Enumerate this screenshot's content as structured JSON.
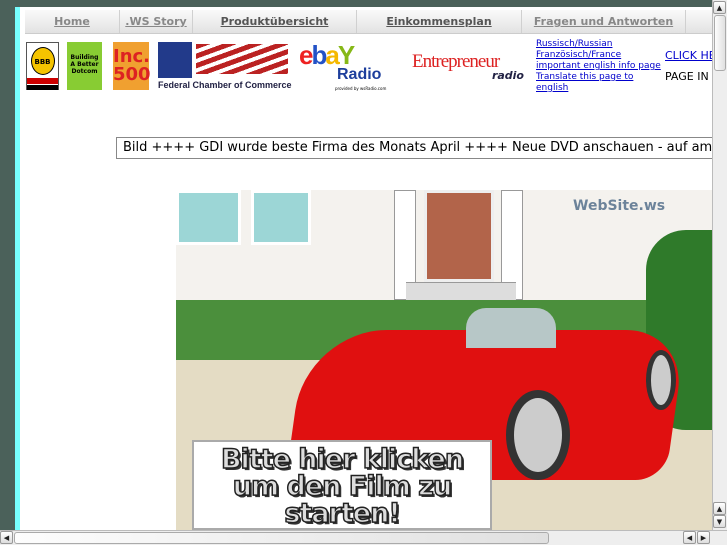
{
  "nav": {
    "items": [
      "Home",
      ".WS Story",
      "Produktübersicht",
      "Einkommensplan",
      "Fragen und Antworten"
    ]
  },
  "logos": {
    "bbb": "BBB Reliability Program",
    "entrepreneur_book": "Building A Better Dotcom",
    "inc500": "Inc. 500",
    "fcc": "Federal Chamber of Commerce",
    "ebay_radio": "ebay Radio",
    "ebay_radio_sub": "provided by wsRadio.com",
    "entrepreneur_radio": "Entrepreneur radio"
  },
  "links": [
    "Russisch/Russian",
    "Französisch/France",
    "important english info page",
    "Translate this page to english"
  ],
  "click_here": "CLICK HE",
  "page_in": "PAGE IN N",
  "ticker": "Bild ++++ GDI wurde beste Firma des Monats April ++++ Neue DVD anschauen - auf amerik",
  "video": {
    "brand": "WebSite.ws",
    "cta": [
      "Bitte hier klicken",
      "um den Film zu",
      "starten!"
    ]
  }
}
